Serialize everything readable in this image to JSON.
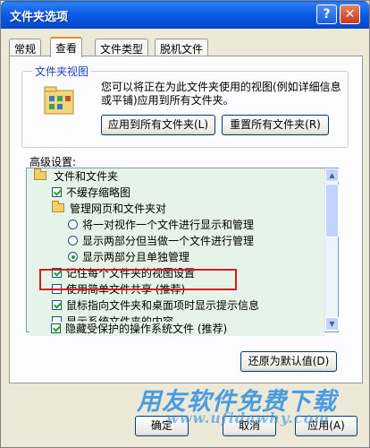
{
  "window": {
    "title": "文件夹选项"
  },
  "tabs": [
    {
      "label": "常规"
    },
    {
      "label": "查看"
    },
    {
      "label": "文件类型"
    },
    {
      "label": "脱机文件"
    }
  ],
  "folder_view": {
    "group_title": "文件夹视图",
    "description": "您可以将正在为此文件夹使用的视图(例如详细信息或平铺)应用到所有文件夹。",
    "apply_button": "应用到所有文件夹(L)",
    "reset_button": "重置所有文件夹(R)"
  },
  "advanced": {
    "label": "高级设置:",
    "items": [
      {
        "type": "folder",
        "label": "文件和文件夹"
      },
      {
        "type": "checkbox",
        "checked": true,
        "label": "不缓存缩略图"
      },
      {
        "type": "folder",
        "label": "管理网页和文件夹对"
      },
      {
        "type": "radio",
        "selected": false,
        "label": "将一对视作一个文件进行显示和管理"
      },
      {
        "type": "radio",
        "selected": false,
        "label": "显示两部分但当做一个文件进行管理"
      },
      {
        "type": "radio",
        "selected": true,
        "label": "显示两部分且单独管理"
      },
      {
        "type": "checkbox",
        "checked": true,
        "label": "记住每个文件夹的视图设置"
      },
      {
        "type": "checkbox",
        "checked": false,
        "label": "使用简单文件共享 (推荐)"
      },
      {
        "type": "checkbox",
        "checked": true,
        "label": "鼠标指向文件夹和桌面项时显示提示信息"
      },
      {
        "type": "checkbox",
        "checked": false,
        "label": "显示系统文件夹的内容"
      },
      {
        "type": "checkbox",
        "checked": true,
        "label": "隐藏受保护的操作系统文件 (推荐)"
      }
    ],
    "restore_button": "还原为默认值(D)"
  },
  "footer": {
    "ok_button": "确定",
    "cancel_button": "取消",
    "apply_button": "应用(A)"
  },
  "watermark": {
    "line1": "用友软件免费下载",
    "line2": "www.ufidawhy.com"
  },
  "colors": {
    "title_bar": "#0d5ee6",
    "tree_background": "#e6f3e8",
    "highlight_border": "#d51d1d",
    "watermark": "#2f8fe0"
  }
}
